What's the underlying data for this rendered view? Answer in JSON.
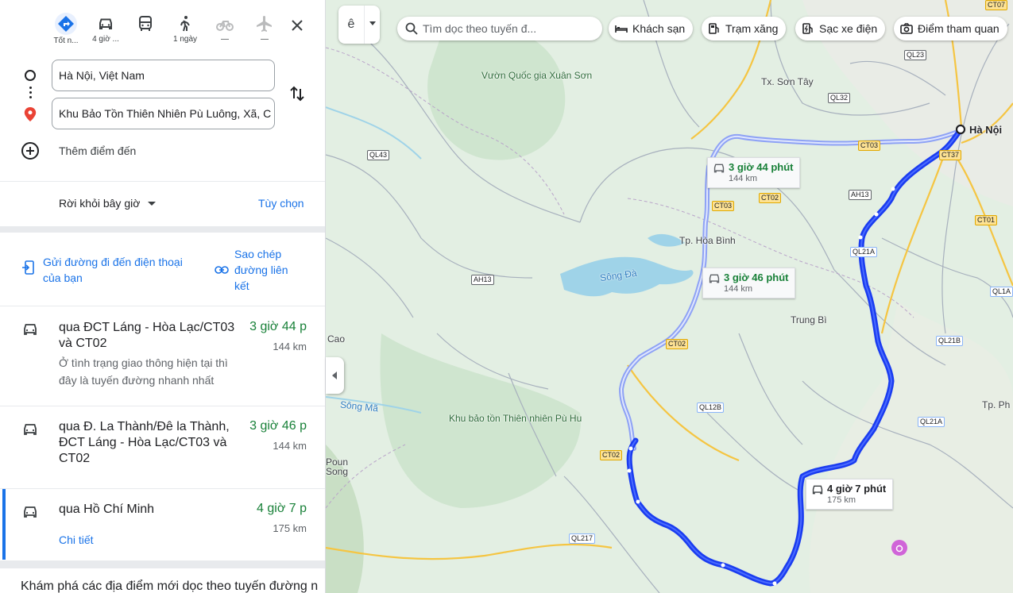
{
  "modes": [
    {
      "name": "best",
      "label": "Tốt n..."
    },
    {
      "name": "car",
      "label": "4 giờ ..."
    },
    {
      "name": "transit",
      "label": ""
    },
    {
      "name": "walk",
      "label": "1 ngày"
    },
    {
      "name": "bike",
      "label": "—"
    },
    {
      "name": "flight",
      "label": "—"
    }
  ],
  "origin": "Hà Nội, Việt Nam",
  "destination": "Khu Bảo Tồn Thiên Nhiên Pù Luông, Xã, C",
  "add_destination": "Thêm điểm đến",
  "depart_label": "Rời khỏi bây giờ",
  "options_label": "Tùy chọn",
  "send_label": "Gửi đường đi đến điện thoại của bạn",
  "copy_label": "Sao chép đường liên kết",
  "routes": [
    {
      "name": "qua ĐCT Láng - Hòa Lạc/CT03 và CT02",
      "time": "3 giờ 44 p",
      "distance": "144 km",
      "note": "Ở tình trạng giao thông hiện tại thì đây là tuyến đường nhanh nhất"
    },
    {
      "name": "qua Đ. La Thành/Đê la Thành, ĐCT Láng - Hòa Lạc/CT03 và CT02",
      "time": "3 giờ 46 p",
      "distance": "144 km"
    },
    {
      "name": "qua Hồ Chí Minh",
      "time": "4 giờ 7 p",
      "distance": "175 km",
      "details_label": "Chi tiết"
    }
  ],
  "explore_label": "Khám phá các địa điểm mới dọc theo tuyến đường n",
  "map": {
    "layer_glyph": "ê",
    "search_placeholder": "Tìm dọc theo tuyến đ...",
    "chips": [
      "Khách sạn",
      "Trạm xăng",
      "Sạc xe điện",
      "Điểm tham quan"
    ],
    "route_labels": [
      {
        "time": "3 giờ 44 phút",
        "distance": "144 km"
      },
      {
        "time": "3 giờ 46 phút",
        "distance": "144 km"
      },
      {
        "time": "4 giờ 7 phút",
        "distance": "175 km"
      }
    ],
    "places": {
      "xuan_son": "Vườn Quốc gia Xuân Sơn",
      "son_tay": "Tx. Sơn Tây",
      "hanoi": "Hà Nội",
      "hoa_binh": "Tp. Hòa Bình",
      "song_da": "Sông Đà",
      "trung_bi": "Trung Bì",
      "cao": "Cao",
      "song_ma": "Sông Mã",
      "pu_hu": "Khu bảo tồn Thiên nhiên Pù Hu",
      "poun_song": "Poun Song",
      "tp_ph": "Tp. Ph"
    },
    "roads": [
      "QL23",
      "QL32",
      "QL43",
      "CT03",
      "CT02",
      "CT37",
      "AH13",
      "QL21A",
      "QL12B",
      "QL217",
      "QL1A",
      "QL21B",
      "CT01",
      "CT07"
    ],
    "colors": {
      "selected_route": "#1a3cf0",
      "alt_route": "#8ea2f5",
      "accent": "#1a73e8",
      "green_time": "#188038"
    }
  }
}
